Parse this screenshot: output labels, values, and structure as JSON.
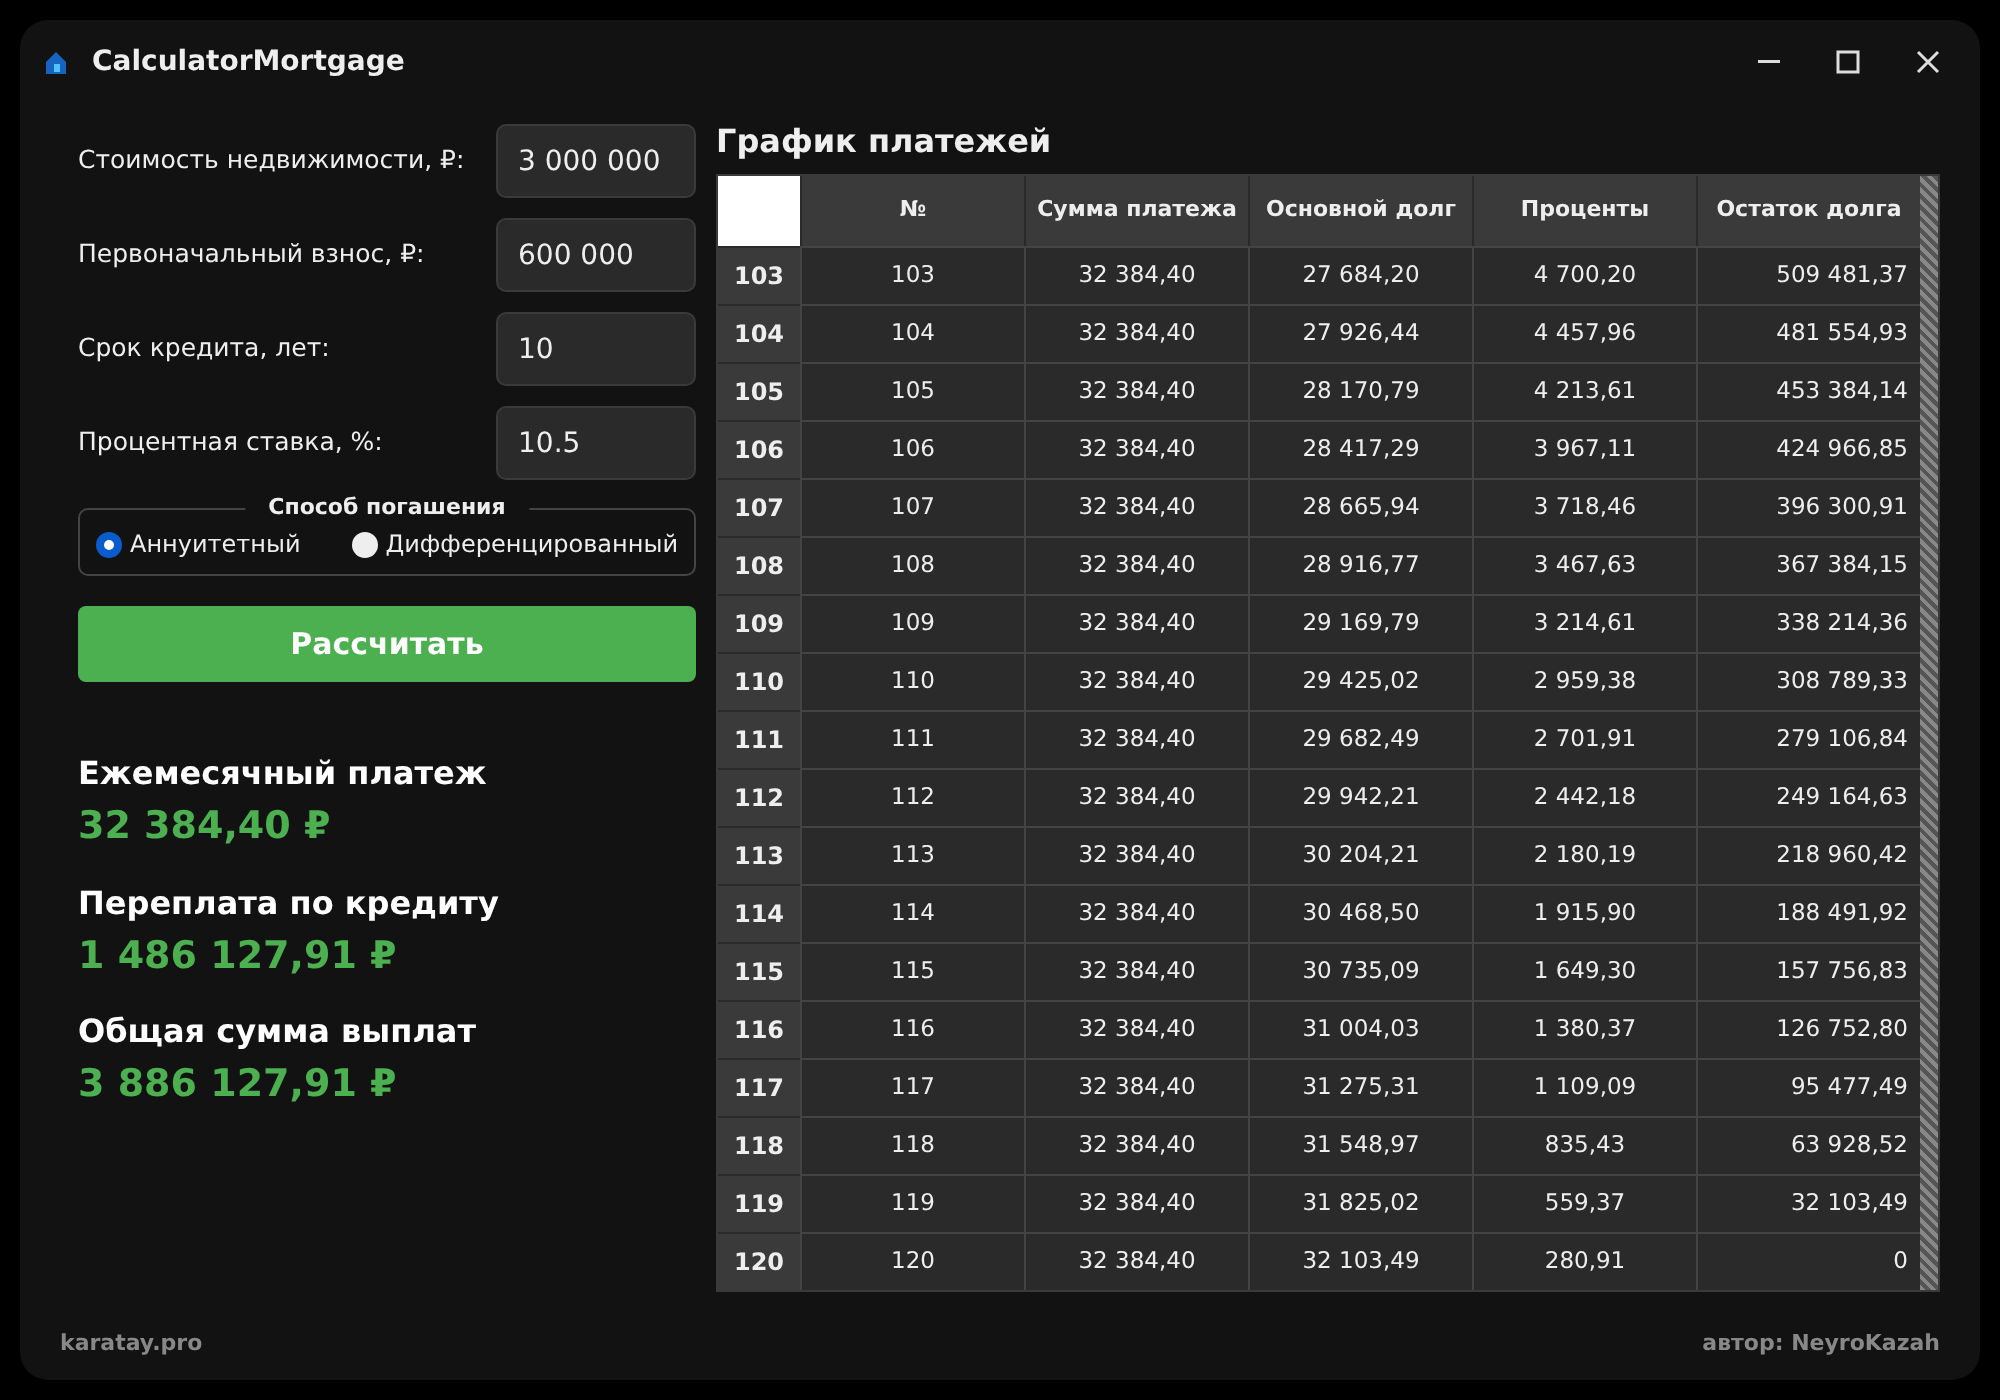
{
  "window": {
    "title": "CalculatorMortgage"
  },
  "form": {
    "fields": [
      {
        "label": "Стоимость недвижимости, ₽:",
        "value": "3 000 000"
      },
      {
        "label": "Первоначальный взнос, ₽:",
        "value": "600 000"
      },
      {
        "label": "Срок кредита, лет:",
        "value": "10"
      },
      {
        "label": "Процентная ставка, %:",
        "value": "10.5"
      }
    ],
    "repayment": {
      "legend": "Способ погашения",
      "options": [
        {
          "label": "Аннуитетный",
          "selected": true
        },
        {
          "label": "Дифференцированный",
          "selected": false
        }
      ]
    },
    "calculate_button": "Рассчитать"
  },
  "results": [
    {
      "label": "Ежемесячный платеж",
      "value": "32 384,40 ₽"
    },
    {
      "label": "Переплата по кредиту",
      "value": "1 486 127,91 ₽"
    },
    {
      "label": "Общая сумма выплат",
      "value": "3 886 127,91 ₽"
    }
  ],
  "schedule": {
    "title": "График платежей",
    "columns": [
      "№",
      "Сумма платежа",
      "Основной долг",
      "Проценты",
      "Остаток долга"
    ],
    "rows": [
      {
        "header": "103",
        "cells": [
          "103",
          "32 384,40",
          "27 684,20",
          "4 700,20",
          "509 481,37"
        ]
      },
      {
        "header": "104",
        "cells": [
          "104",
          "32 384,40",
          "27 926,44",
          "4 457,96",
          "481 554,93"
        ]
      },
      {
        "header": "105",
        "cells": [
          "105",
          "32 384,40",
          "28 170,79",
          "4 213,61",
          "453 384,14"
        ]
      },
      {
        "header": "106",
        "cells": [
          "106",
          "32 384,40",
          "28 417,29",
          "3 967,11",
          "424 966,85"
        ]
      },
      {
        "header": "107",
        "cells": [
          "107",
          "32 384,40",
          "28 665,94",
          "3 718,46",
          "396 300,91"
        ]
      },
      {
        "header": "108",
        "cells": [
          "108",
          "32 384,40",
          "28 916,77",
          "3 467,63",
          "367 384,15"
        ]
      },
      {
        "header": "109",
        "cells": [
          "109",
          "32 384,40",
          "29 169,79",
          "3 214,61",
          "338 214,36"
        ]
      },
      {
        "header": "110",
        "cells": [
          "110",
          "32 384,40",
          "29 425,02",
          "2 959,38",
          "308 789,33"
        ]
      },
      {
        "header": "111",
        "cells": [
          "111",
          "32 384,40",
          "29 682,49",
          "2 701,91",
          "279 106,84"
        ]
      },
      {
        "header": "112",
        "cells": [
          "112",
          "32 384,40",
          "29 942,21",
          "2 442,18",
          "249 164,63"
        ]
      },
      {
        "header": "113",
        "cells": [
          "113",
          "32 384,40",
          "30 204,21",
          "2 180,19",
          "218 960,42"
        ]
      },
      {
        "header": "114",
        "cells": [
          "114",
          "32 384,40",
          "30 468,50",
          "1 915,90",
          "188 491,92"
        ]
      },
      {
        "header": "115",
        "cells": [
          "115",
          "32 384,40",
          "30 735,09",
          "1 649,30",
          "157 756,83"
        ]
      },
      {
        "header": "116",
        "cells": [
          "116",
          "32 384,40",
          "31 004,03",
          "1 380,37",
          "126 752,80"
        ]
      },
      {
        "header": "117",
        "cells": [
          "117",
          "32 384,40",
          "31 275,31",
          "1 109,09",
          "95 477,49"
        ]
      },
      {
        "header": "118",
        "cells": [
          "118",
          "32 384,40",
          "31 548,97",
          "835,43",
          "63 928,52"
        ]
      },
      {
        "header": "119",
        "cells": [
          "119",
          "32 384,40",
          "31 825,02",
          "559,37",
          "32 103,49"
        ]
      },
      {
        "header": "120",
        "cells": [
          "120",
          "32 384,40",
          "32 103,49",
          "280,91",
          "0"
        ]
      }
    ]
  },
  "footer": {
    "left": "karatay.pro",
    "right": "автор: NeyroKazah"
  }
}
